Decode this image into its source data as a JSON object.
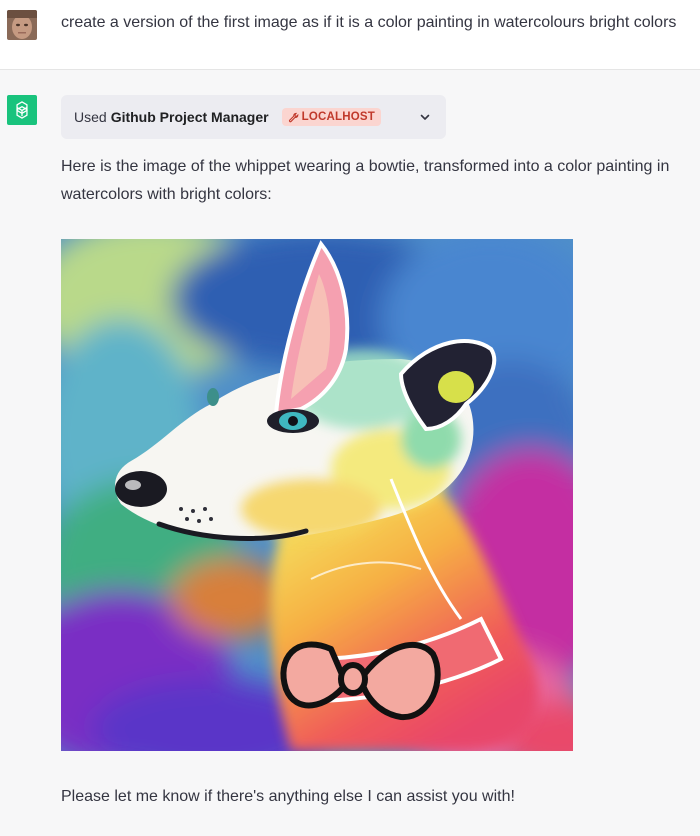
{
  "user_message": {
    "text": "create a version of the first image as if it is a color painting in watercolours bright colors"
  },
  "assistant": {
    "plugin": {
      "prefix": "Used",
      "name": "Github Project Manager",
      "badge": "LOCALHOST",
      "badge_icon": "wrench-icon",
      "expand_icon": "chevron-down-icon"
    },
    "intro": "Here is the image of the whippet wearing a bowtie, transformed into a color painting in watercolors with bright colors:",
    "outro": "Please let me know if there's anything else I can assist you with!"
  },
  "colors": {
    "assistant_avatar": "#19c37d",
    "badge_bg": "#fbd5d0",
    "badge_text": "#c0392b",
    "text": "#343541"
  }
}
